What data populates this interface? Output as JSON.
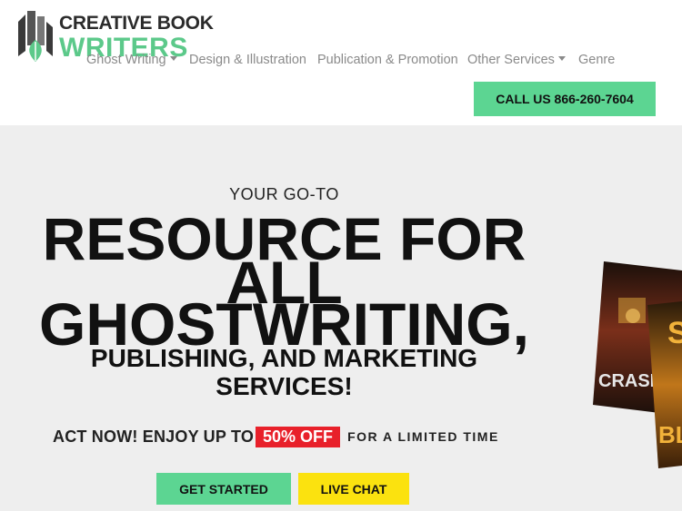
{
  "logo": {
    "line1": "CREATIVE BOOK",
    "line2": "WRITERS"
  },
  "nav": {
    "items": [
      {
        "label": "Ghost Writing",
        "dropdown": true
      },
      {
        "label": "Design & Illustration",
        "dropdown": false
      },
      {
        "label": "Publication & Promotion",
        "dropdown": false
      },
      {
        "label": "Other Services",
        "dropdown": true
      },
      {
        "label": "Genre",
        "dropdown": false
      }
    ]
  },
  "header": {
    "call_label": "CALL US 866-260-7604"
  },
  "hero": {
    "eyebrow": "YOUR GO-TO",
    "headline_line1": "RESOURCE FOR",
    "headline_line2": "ALL",
    "headline_line3": "GHOSTWRITING,",
    "subhead_line1": "PUBLISHING, AND MARKETING",
    "subhead_line2": "SERVICES!",
    "offer_lead": "ACT NOW! ENJOY UP TO",
    "offer_badge": "50% OFF",
    "offer_tail": "FOR A LIMITED TIME",
    "cta_primary": "GET STARTED",
    "cta_secondary": "LIVE CHAT"
  },
  "books": {
    "cover1_title": "CRASH",
    "cover2_letters": "S",
    "cover2_bottom": "BLO"
  },
  "colors": {
    "accent_green": "#5cd592",
    "logo_green": "#5cc98a",
    "offer_red": "#e8202a",
    "chat_yellow": "#fbe20f",
    "hero_bg": "#eeeeee"
  }
}
